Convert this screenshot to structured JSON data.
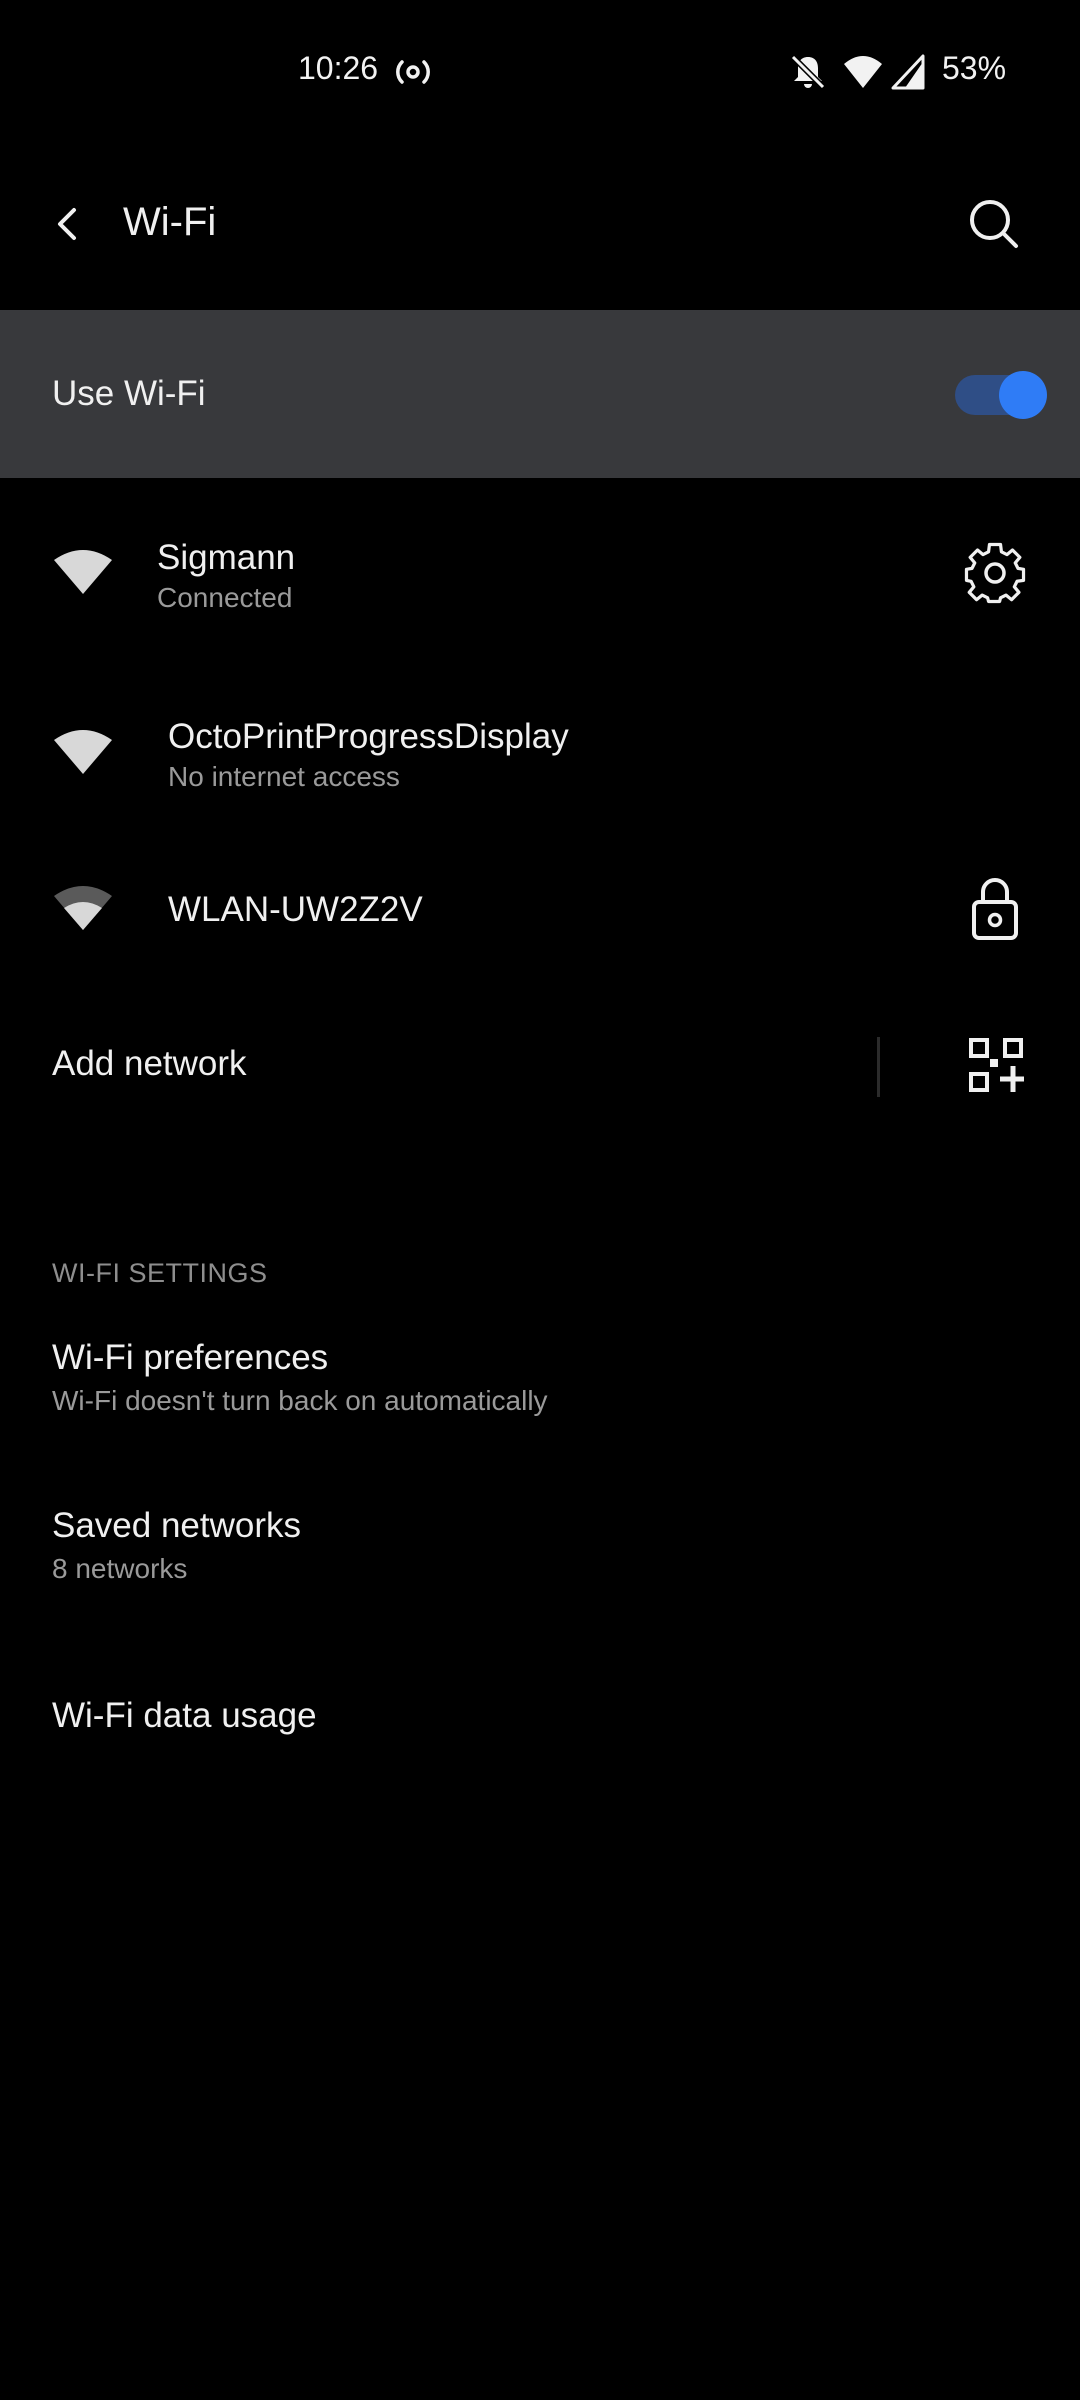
{
  "status_bar": {
    "time": "10:26",
    "battery": "53%",
    "icons": [
      "hotspot-icon",
      "bell-off-icon",
      "wifi-icon",
      "signal-icon"
    ]
  },
  "app_bar": {
    "title": "Wi-Fi",
    "back_icon": "back-arrow-icon",
    "search_icon": "search-icon"
  },
  "use_wifi": {
    "label": "Use Wi-Fi",
    "enabled": true
  },
  "networks": [
    {
      "name": "Sigmann",
      "status": "Connected",
      "icon": "wifi-full-icon",
      "action_icon": "gear-icon"
    },
    {
      "name": "OctoPrintProgressDisplay",
      "status": "No internet access",
      "icon": "wifi-full-icon",
      "action_icon": ""
    },
    {
      "name": "WLAN-UW2Z2V",
      "status": "",
      "icon": "wifi-partial-icon",
      "action_icon": "lock-icon"
    }
  ],
  "add_network": {
    "label": "Add network",
    "qr_icon": "qr-add-icon"
  },
  "wifi_settings": {
    "header": "WI-FI SETTINGS",
    "items": [
      {
        "title": "Wi-Fi preferences",
        "subtitle": "Wi-Fi doesn't turn back on automatically"
      },
      {
        "title": "Saved networks",
        "subtitle": "8 networks"
      },
      {
        "title": "Wi-Fi data usage",
        "subtitle": ""
      }
    ]
  },
  "colors": {
    "background": "#000000",
    "row_highlight": "#38393c",
    "accent": "#2f7cf6",
    "toggle_track": "#2f4e86",
    "secondary_text": "#9a9a9a"
  }
}
